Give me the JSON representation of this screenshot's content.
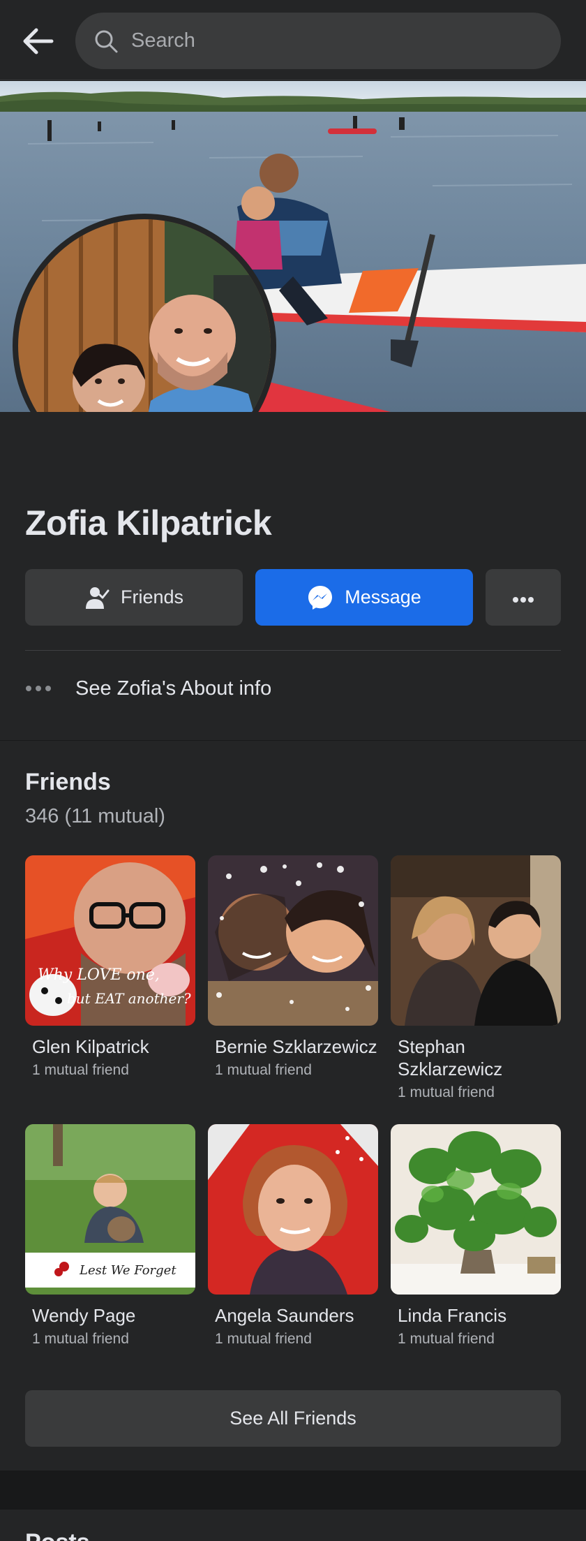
{
  "search": {
    "placeholder": "Search"
  },
  "profile": {
    "name": "Zofia Kilpatrick",
    "actions": {
      "friends_label": "Friends",
      "message_label": "Message"
    },
    "about_label": "See Zofia's About info"
  },
  "friends": {
    "title": "Friends",
    "count": "346 (11 mutual)",
    "items": [
      {
        "name": "Glen Kilpatrick",
        "mutual": "1 mutual friend"
      },
      {
        "name": "Bernie Szklarzewicz",
        "mutual": "1 mutual friend"
      },
      {
        "name": "Stephan Szklarzewicz",
        "mutual": "1 mutual friend"
      },
      {
        "name": "Wendy Page",
        "mutual": "1 mutual friend"
      },
      {
        "name": "Angela Saunders",
        "mutual": "1 mutual friend"
      },
      {
        "name": "Linda Francis",
        "mutual": "1 mutual friend"
      }
    ],
    "see_all_label": "See All Friends"
  },
  "photo_text": {
    "glen_line1": "Why LOVE one,",
    "glen_line2": "but EAT another?",
    "wendy_banner": "Lest We Forget"
  },
  "posts": {
    "title": "Posts"
  },
  "colors": {
    "background": "#18191a",
    "surface": "#242526",
    "button": "#3a3b3c",
    "accent": "#1b6ce8",
    "text_primary": "#e4e6eb",
    "text_secondary": "#b0b3b8"
  },
  "icons": {
    "back": "back-arrow-icon",
    "search": "search-icon",
    "friends": "friend-person-check-icon",
    "message": "messenger-icon",
    "more": "more-dots-icon",
    "about": "ellipsis-icon"
  }
}
